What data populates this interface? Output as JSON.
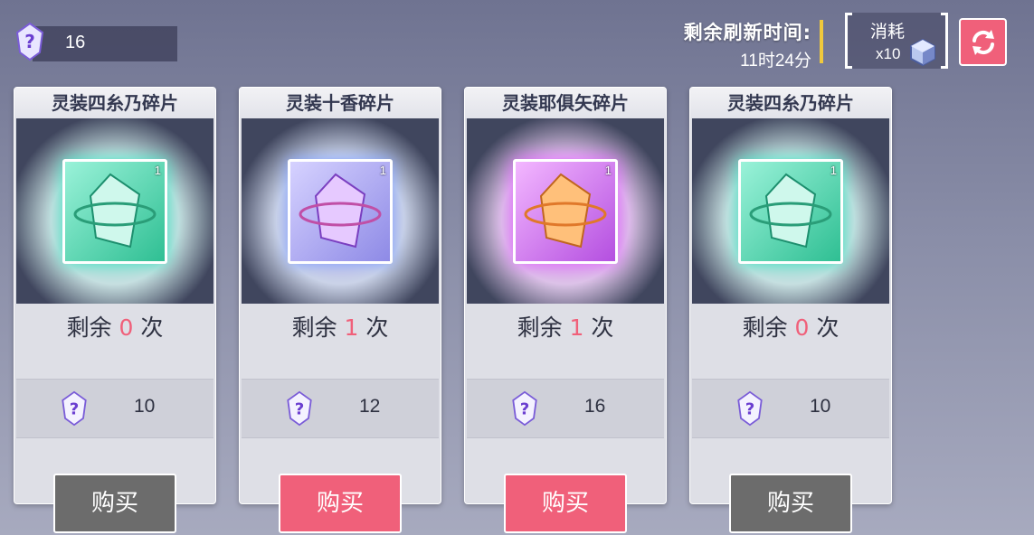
{
  "currency": {
    "amount": "16"
  },
  "refresh": {
    "label": "剩余刷新时间:",
    "time": "11时24分"
  },
  "cost": {
    "label": "消耗",
    "amount": "x10"
  },
  "cards": [
    {
      "title": "灵装四糸乃碎片",
      "remain_prefix": "剩余",
      "remain_count": "0",
      "remain_suffix": "次",
      "price": "10",
      "buy": "购买",
      "color": "#3fe0c0",
      "count": "1"
    },
    {
      "title": "灵装十香碎片",
      "remain_prefix": "剩余",
      "remain_count": "1",
      "remain_suffix": "次",
      "price": "12",
      "buy": "购买",
      "color": "#8a6cf0",
      "count": "1"
    },
    {
      "title": "灵装耶俱矢碎片",
      "remain_prefix": "剩余",
      "remain_count": "1",
      "remain_suffix": "次",
      "price": "16",
      "buy": "购买",
      "color": "#d34cf0",
      "count": "1"
    },
    {
      "title": "灵装四糸乃碎片",
      "remain_prefix": "剩余",
      "remain_count": "0",
      "remain_suffix": "次",
      "price": "10",
      "buy": "购买",
      "color": "#3fe0c0",
      "count": "1"
    }
  ]
}
